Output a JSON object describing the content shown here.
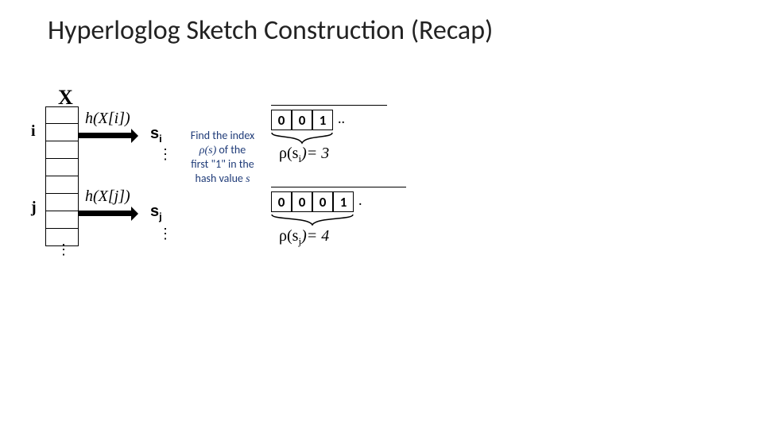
{
  "title": "Hyperloglog Sketch Construction (Recap)",
  "x_label": "X",
  "row_i_label": "i",
  "row_j_label": "j",
  "h_i": "h(X[i])",
  "h_j": "h(X[j])",
  "s_i_base": "s",
  "s_i_sub": "i",
  "s_j_base": "s",
  "s_j_sub": "j",
  "explain_line1": "Find the index",
  "explain_rho": "ρ(s)",
  "explain_line2": " of the",
  "explain_line3": "first \"1\" in the",
  "explain_line4": "hash value ",
  "explain_var": "s",
  "bits_i": [
    "0",
    "0",
    "1"
  ],
  "bits_i_trail": "..",
  "bits_j": [
    "0",
    "0",
    "0",
    "1"
  ],
  "bits_j_trail": ".",
  "rho_i_expr": "ρ(s",
  "rho_i_sub": "i",
  "rho_i_val": ")= 3",
  "rho_j_expr": "ρ(s",
  "rho_j_sub": "j",
  "rho_j_val": ")= 4",
  "vdots": "⋮"
}
